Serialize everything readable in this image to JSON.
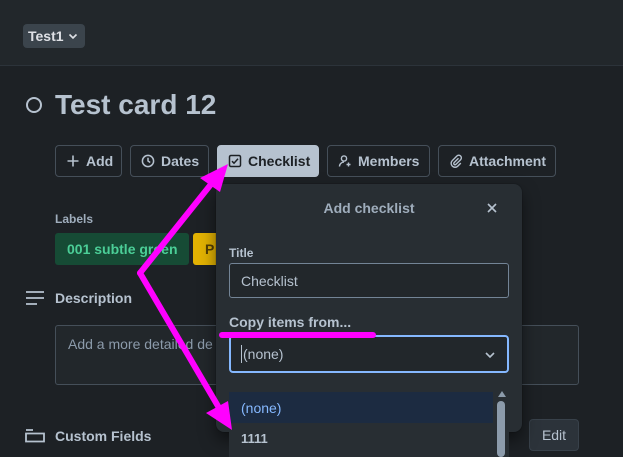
{
  "header": {
    "board_name": "Test1"
  },
  "card": {
    "title": "Test card 12"
  },
  "actions": [
    {
      "label": "Add",
      "icon": "plus-icon"
    },
    {
      "label": "Dates",
      "icon": "clock-icon"
    },
    {
      "label": "Checklist",
      "icon": "checkbox-icon"
    },
    {
      "label": "Members",
      "icon": "add-member-icon"
    },
    {
      "label": "Attachment",
      "icon": "paperclip-icon"
    }
  ],
  "labels": {
    "heading": "Labels",
    "items": [
      {
        "text": "001 subtle green",
        "color": "#164b35",
        "text_color": "#4bce97"
      },
      {
        "text": "P",
        "color": "#e2b203",
        "text_color": "#533f04"
      }
    ]
  },
  "description": {
    "title": "Description",
    "placeholder": "Add a more detailed de"
  },
  "custom_fields": {
    "title": "Custom Fields",
    "edit_label": "Edit"
  },
  "popover": {
    "title": "Add checklist",
    "title_field_label": "Title",
    "title_value": "Checklist",
    "copy_label": "Copy items from...",
    "copy_selected": "(none)",
    "options": [
      "(none)",
      "1111"
    ]
  },
  "colors": {
    "background": "#1d2125",
    "accent_focus": "#85b8ff",
    "annotation": "#ff00ff"
  }
}
